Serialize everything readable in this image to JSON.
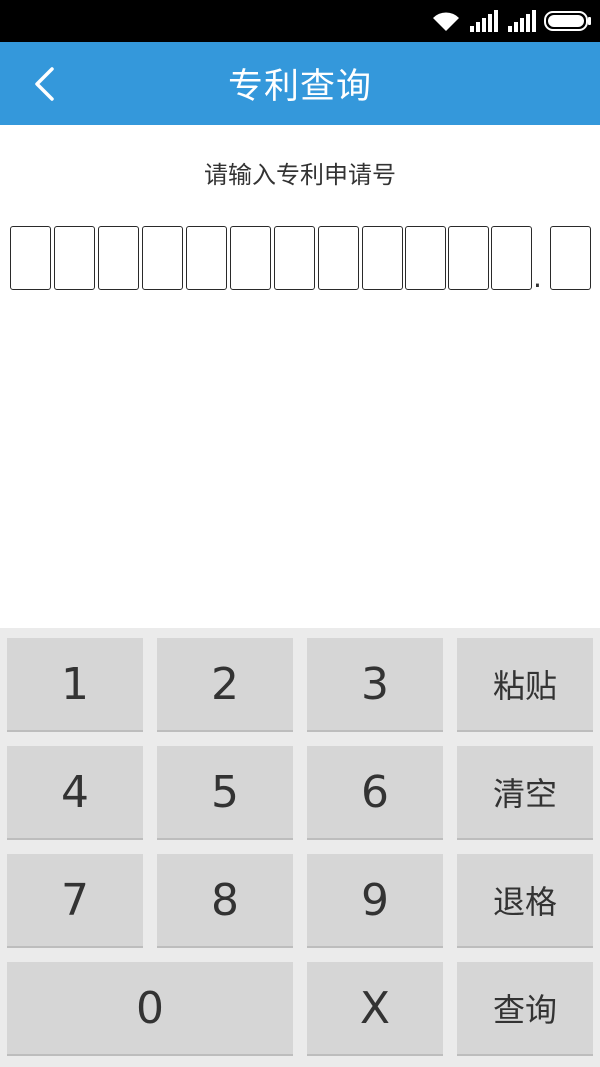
{
  "header": {
    "title": "专利查询",
    "back_icon": "chevron-left-icon"
  },
  "prompt": "请输入专利申请号",
  "digits": [
    "",
    "",
    "",
    "",
    "",
    "",
    "",
    "",
    "",
    "",
    "",
    "",
    ""
  ],
  "separator": ".",
  "keypad": {
    "row1": [
      "1",
      "2",
      "3",
      "粘贴"
    ],
    "row2": [
      "4",
      "5",
      "6",
      "清空"
    ],
    "row3": [
      "7",
      "8",
      "9",
      "退格"
    ],
    "row4": [
      "0",
      "X",
      "查询"
    ]
  },
  "colors": {
    "title_bar": "#3498db",
    "status_bar": "#000000",
    "key_bg": "#d6d6d6",
    "keypad_bg": "#ebebeb"
  }
}
